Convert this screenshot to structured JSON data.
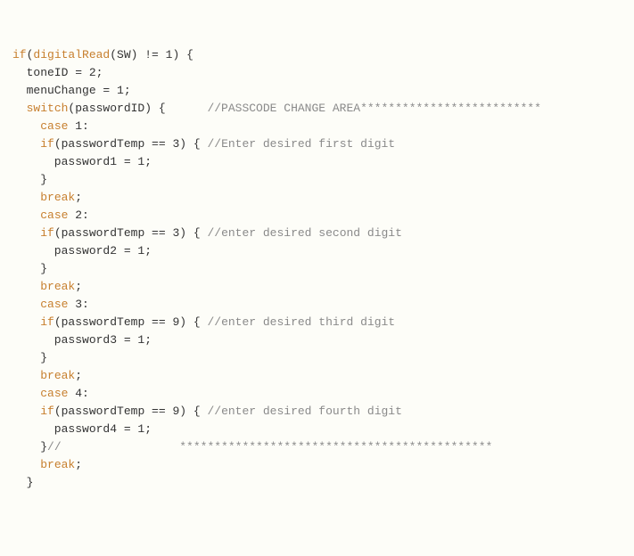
{
  "code": {
    "l01_kw_if": "if",
    "l01_op1": "(",
    "l01_fn": "digitalRead",
    "l01_rest": "(SW) != 1) {",
    "l02": "  toneID = 2;",
    "l03": "  menuChange = 1;",
    "l04_sp": "  ",
    "l04_kw_switch": "switch",
    "l04_rest": "(passwordID) {      ",
    "l04_cm": "//PASSCODE CHANGE AREA**************************",
    "l05_sp": "    ",
    "l05_kw_case": "case",
    "l05_rest": " 1:",
    "l06_sp": "    ",
    "l06_kw_if": "if",
    "l06_rest": "(passwordTemp == 3) { ",
    "l06_cm": "//Enter desired first digit",
    "l07": "      password1 = 1;",
    "l08": "    }",
    "l09_sp": "    ",
    "l09_kw_break": "break",
    "l09_rest": ";",
    "l10_sp": "    ",
    "l10_kw_case": "case",
    "l10_rest": " 2:",
    "l11_sp": "    ",
    "l11_kw_if": "if",
    "l11_rest": "(passwordTemp == 3) { ",
    "l11_cm": "//enter desired second digit",
    "l12": "      password2 = 1;",
    "l13": "    }",
    "l14_sp": "    ",
    "l14_kw_break": "break",
    "l14_rest": ";",
    "l15_sp": "    ",
    "l15_kw_case": "case",
    "l15_rest": " 3:",
    "l16_sp": "    ",
    "l16_kw_if": "if",
    "l16_rest": "(passwordTemp == 9) { ",
    "l16_cm": "//enter desired third digit",
    "l17": "      password3 = 1;",
    "l18": "    }",
    "l19_sp": "    ",
    "l19_kw_break": "break",
    "l19_rest": ";",
    "l20_sp": "    ",
    "l20_kw_case": "case",
    "l20_rest": " 4:",
    "l21_sp": "    ",
    "l21_kw_if": "if",
    "l21_rest": "(passwordTemp == 9) { ",
    "l21_cm": "//enter desired fourth digit",
    "l22": "      password4 = 1;",
    "l23_pl": "    }",
    "l23_cm": "//                 *********************************************",
    "l24_sp": "    ",
    "l24_kw_break": "break",
    "l24_rest": ";",
    "l25": "  }"
  }
}
